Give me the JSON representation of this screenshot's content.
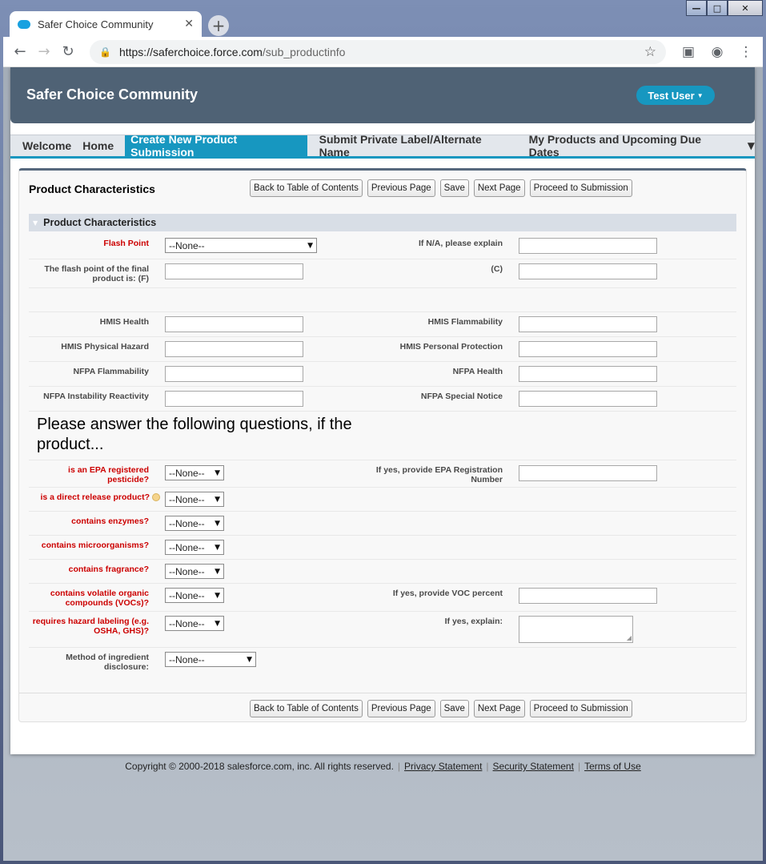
{
  "browser": {
    "tab_title": "Safer Choice Community",
    "url_host": "https://saferchoice.force.com",
    "url_path": "/sub_productinfo"
  },
  "header": {
    "site_title": "Safer Choice Community",
    "user_label": "Test User"
  },
  "nav": {
    "items": [
      "Welcome",
      "Home",
      "Create New Product Submission",
      "Submit Private Label/Alternate Name",
      "My Products and Upcoming Due Dates"
    ],
    "active_index": 2
  },
  "panel": {
    "title": "Product Characteristics",
    "buttons": [
      "Back to Table of Contents",
      "Previous Page",
      "Save",
      "Next Page",
      "Proceed to Submission"
    ],
    "section_title": "Product Characteristics"
  },
  "fields": {
    "flash_point": {
      "label": "Flash Point",
      "value": "--None--"
    },
    "na_explain": {
      "label": "If N/A, please explain"
    },
    "flash_f": {
      "label": "The flash point of the final product is: (F)"
    },
    "flash_c": {
      "label": "(C)"
    },
    "hmis_health": {
      "label": "HMIS Health"
    },
    "hmis_flammability": {
      "label": "HMIS Flammability"
    },
    "hmis_physical": {
      "label": "HMIS Physical Hazard"
    },
    "hmis_ppe": {
      "label": "HMIS Personal Protection"
    },
    "nfpa_flammability": {
      "label": "NFPA Flammability"
    },
    "nfpa_health": {
      "label": "NFPA Health"
    },
    "nfpa_instability": {
      "label": "NFPA Instability Reactivity"
    },
    "nfpa_special": {
      "label": "NFPA Special Notice"
    }
  },
  "questions": {
    "instruction": "Please answer the following questions, if the product...",
    "epa_pesticide": {
      "label": "is an EPA registered pesticide?",
      "value": "--None--"
    },
    "epa_reg_num": {
      "label": "If yes, provide EPA Registration Number"
    },
    "direct_release": {
      "label": "is a direct release product?",
      "value": "--None--"
    },
    "enzymes": {
      "label": "contains enzymes?",
      "value": "--None--"
    },
    "microorganisms": {
      "label": "contains microorganisms?",
      "value": "--None--"
    },
    "fragrance": {
      "label": "contains fragrance?",
      "value": "--None--"
    },
    "vocs": {
      "label": "contains volatile organic compounds (VOCs)?",
      "value": "--None--"
    },
    "voc_percent": {
      "label": "If yes, provide VOC percent"
    },
    "hazard_labeling": {
      "label": "requires hazard labeling (e.g. OSHA, GHS)?",
      "value": "--None--"
    },
    "hazard_explain": {
      "label": "If yes, explain:"
    },
    "disclosure": {
      "label": "Method of ingredient disclosure:",
      "value": "--None--"
    }
  },
  "footer": {
    "copyright": "Copyright © 2000-2018 salesforce.com, inc. All rights reserved.",
    "links": [
      "Privacy Statement",
      "Security Statement",
      "Terms of Use"
    ]
  }
}
